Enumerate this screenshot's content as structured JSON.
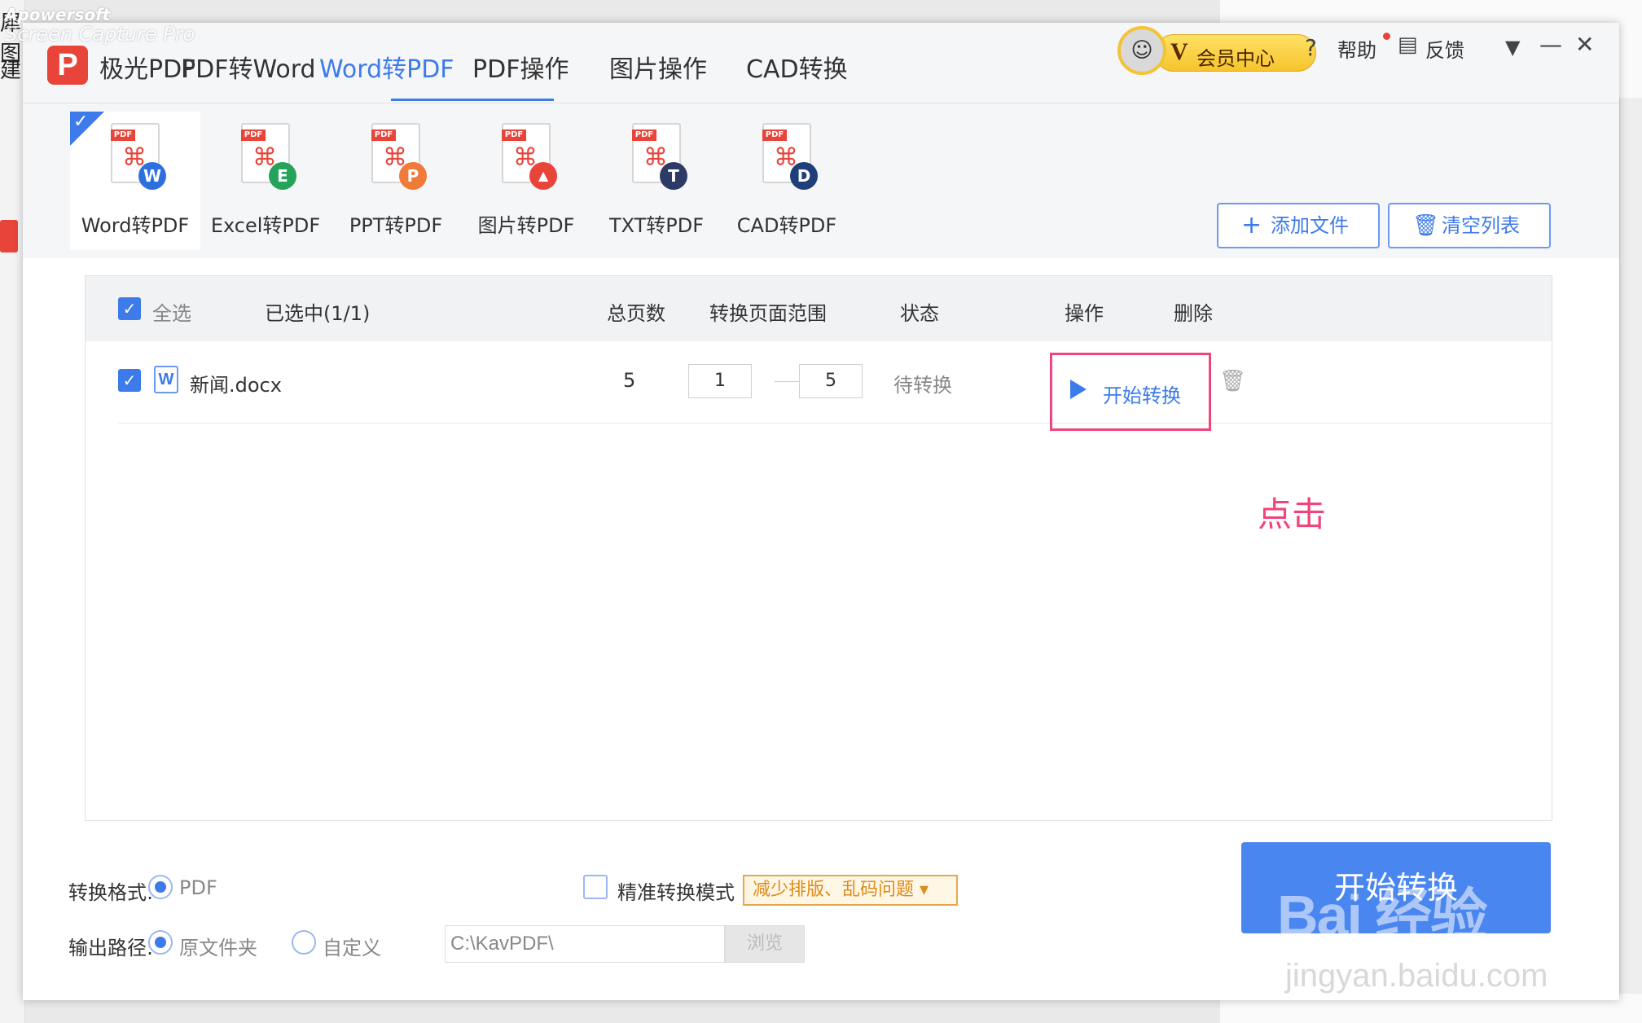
{
  "background": {
    "left_chars": [
      "犀图",
      "建"
    ],
    "watermark_app": "Apowersoft",
    "watermark_sub": "Screen Capture Pro"
  },
  "window": {
    "app_name": "极光PDF",
    "nav_tabs": [
      {
        "label": "PDF转Word",
        "active": false
      },
      {
        "label": "Word转PDF",
        "active": true
      },
      {
        "label": "PDF操作",
        "active": false
      },
      {
        "label": "图片操作",
        "active": false
      },
      {
        "label": "CAD转换",
        "active": false
      }
    ],
    "member_center": "会员中心",
    "member_v": "V",
    "help": "帮助",
    "feedback": "反馈",
    "accent_color": "#3d7bea"
  },
  "tools": [
    {
      "label": "Word转PDF",
      "badge": "W",
      "badge_color": "#2e6fe0",
      "selected": true
    },
    {
      "label": "Excel转PDF",
      "badge": "E",
      "badge_color": "#25a35a",
      "selected": false
    },
    {
      "label": "PPT转PDF",
      "badge": "P",
      "badge_color": "#f07a3a",
      "selected": false
    },
    {
      "label": "图片转PDF",
      "badge": "▲",
      "badge_color": "#e8443a",
      "selected": false
    },
    {
      "label": "TXT转PDF",
      "badge": "T",
      "badge_color": "#2d3a66",
      "selected": false
    },
    {
      "label": "CAD转PDF",
      "badge": "D",
      "badge_color": "#1f3f7a",
      "selected": false
    }
  ],
  "buttons": {
    "add_file": "添加文件",
    "clear_list": "清空列表"
  },
  "table": {
    "select_all": "全选",
    "selected_count": "已选中(1/1)",
    "headers": {
      "pages": "总页数",
      "range": "转换页面范围",
      "status": "状态",
      "action": "操作",
      "delete": "删除"
    },
    "rows": [
      {
        "filename": "新闻.docx",
        "pages": "5",
        "range_from": "1",
        "range_to": "5",
        "status": "待转换",
        "action": "开始转换"
      }
    ]
  },
  "annotation": "点击",
  "settings": {
    "format_label": "转换格式:",
    "format_option": "PDF",
    "precise_label": "精准转换模式",
    "precise_tip": "减少排版、乱码问题",
    "output_label": "输出路径:",
    "output_original": "原文件夹",
    "output_custom": "自定义",
    "output_path": "C:\\KavPDF\\",
    "browse": "浏览",
    "start": "开始转换"
  },
  "watermark": {
    "brand": "Bai 经验",
    "url": "jingyan.baidu.com"
  }
}
